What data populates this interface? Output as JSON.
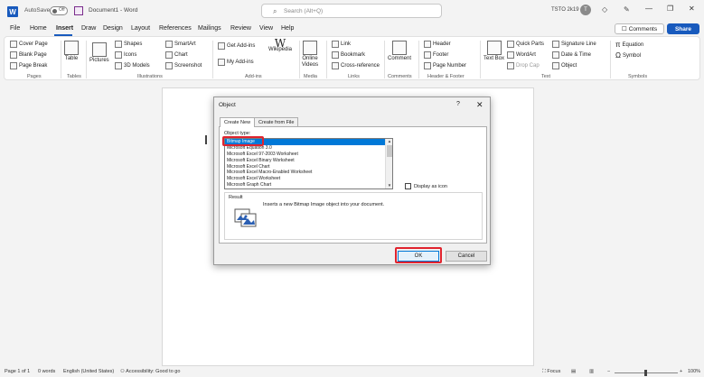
{
  "titlebar": {
    "autosave_label": "AutoSave",
    "toggle_state": "Off",
    "doc_title": "Document1 - Word",
    "search_placeholder": "Search (Alt+Q)",
    "user_name": "TSTO 2k19",
    "avatar_initial": "T",
    "minimize": "—",
    "restore": "❐",
    "close": "✕"
  },
  "menu": {
    "tabs": [
      "File",
      "Home",
      "Insert",
      "Draw",
      "Design",
      "Layout",
      "References",
      "Mailings",
      "Review",
      "View",
      "Help"
    ],
    "active": "Insert",
    "comments_label": "Comments",
    "share_label": "Share"
  },
  "ribbon": {
    "pages": {
      "cover_page": "Cover Page",
      "blank_page": "Blank Page",
      "page_break": "Page Break",
      "group": "Pages"
    },
    "tables": {
      "table": "Table",
      "group": "Tables"
    },
    "illustrations": {
      "pictures": "Pictures",
      "shapes": "Shapes",
      "icons": "Icons",
      "models": "3D Models",
      "smartart": "SmartArt",
      "chart": "Chart",
      "screenshot": "Screenshot",
      "group": "Illustrations"
    },
    "addins": {
      "get_addins": "Get Add-ins",
      "my_addins": "My Add-ins",
      "wikipedia": "Wikipedia",
      "group": "Add-ins"
    },
    "media": {
      "online_videos": "Online Videos",
      "group": "Media"
    },
    "links": {
      "link": "Link",
      "bookmark": "Bookmark",
      "cross_reference": "Cross-reference",
      "group": "Links"
    },
    "comments": {
      "comment": "Comment",
      "group": "Comments"
    },
    "header_footer": {
      "header": "Header",
      "footer": "Footer",
      "page_number": "Page Number",
      "group": "Header & Footer"
    },
    "text": {
      "text_box": "Text Box",
      "quick_parts": "Quick Parts",
      "wordart": "WordArt",
      "drop_cap": "Drop Cap",
      "signature_line": "Signature Line",
      "date_time": "Date & Time",
      "object": "Object",
      "group": "Text"
    },
    "symbols": {
      "equation": "Equation",
      "symbol": "Symbol",
      "group": "Symbols"
    }
  },
  "dialog": {
    "title": "Object",
    "help": "?",
    "close": "✕",
    "tabs": [
      "Create New",
      "Create from File"
    ],
    "object_type_label": "Object type:",
    "items": [
      "Bitmap Image",
      "Microsoft Equation 3.0",
      "Microsoft Excel 97-2003 Worksheet",
      "Microsoft Excel Binary Worksheet",
      "Microsoft Excel Chart",
      "Microsoft Excel Macro-Enabled Worksheet",
      "Microsoft Excel Worksheet",
      "Microsoft Graph Chart"
    ],
    "selected_index": 0,
    "display_as_icon": "Display as icon",
    "result_label": "Result",
    "result_text": "Inserts a new Bitmap Image object into your document.",
    "ok_label": "OK",
    "cancel_label": "Cancel"
  },
  "status": {
    "page": "Page 1 of 1",
    "words": "0 words",
    "language": "English (United States)",
    "accessibility": "Accessibility: Good to go",
    "focus": "Focus",
    "zoom_minus": "−",
    "zoom_plus": "+",
    "zoom": "100%"
  },
  "colors": {
    "accent": "#185abd",
    "highlight": "#e0232e",
    "selection": "#0078d7"
  }
}
